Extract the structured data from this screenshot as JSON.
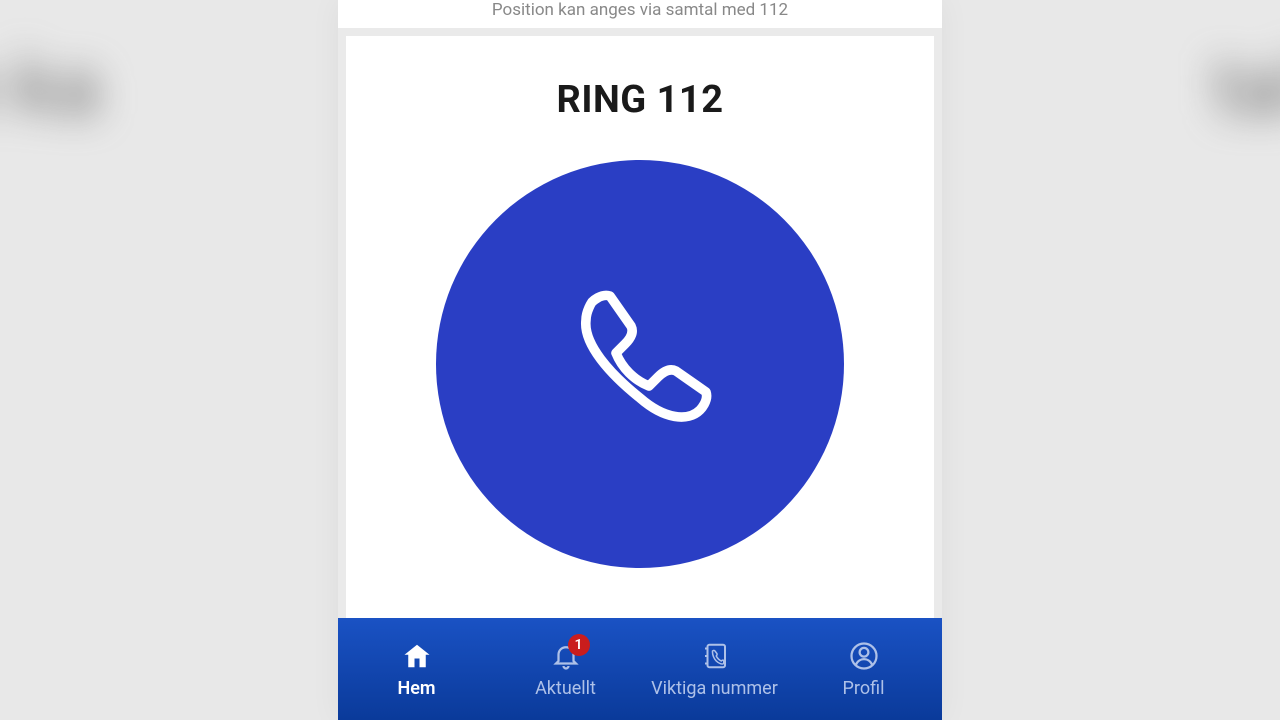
{
  "hint": "Position kan anges via samtal med 112",
  "call": {
    "title": "RING 112"
  },
  "tabs": {
    "home": {
      "label": "Hem"
    },
    "current": {
      "label": "Aktuellt",
      "badge": "1"
    },
    "numbers": {
      "label": "Viktiga nummer"
    },
    "profile": {
      "label": "Profil"
    }
  },
  "colors": {
    "accent": "#2a3ec4",
    "navbar": "#0a3a9a",
    "badge": "#c91d1d"
  }
}
